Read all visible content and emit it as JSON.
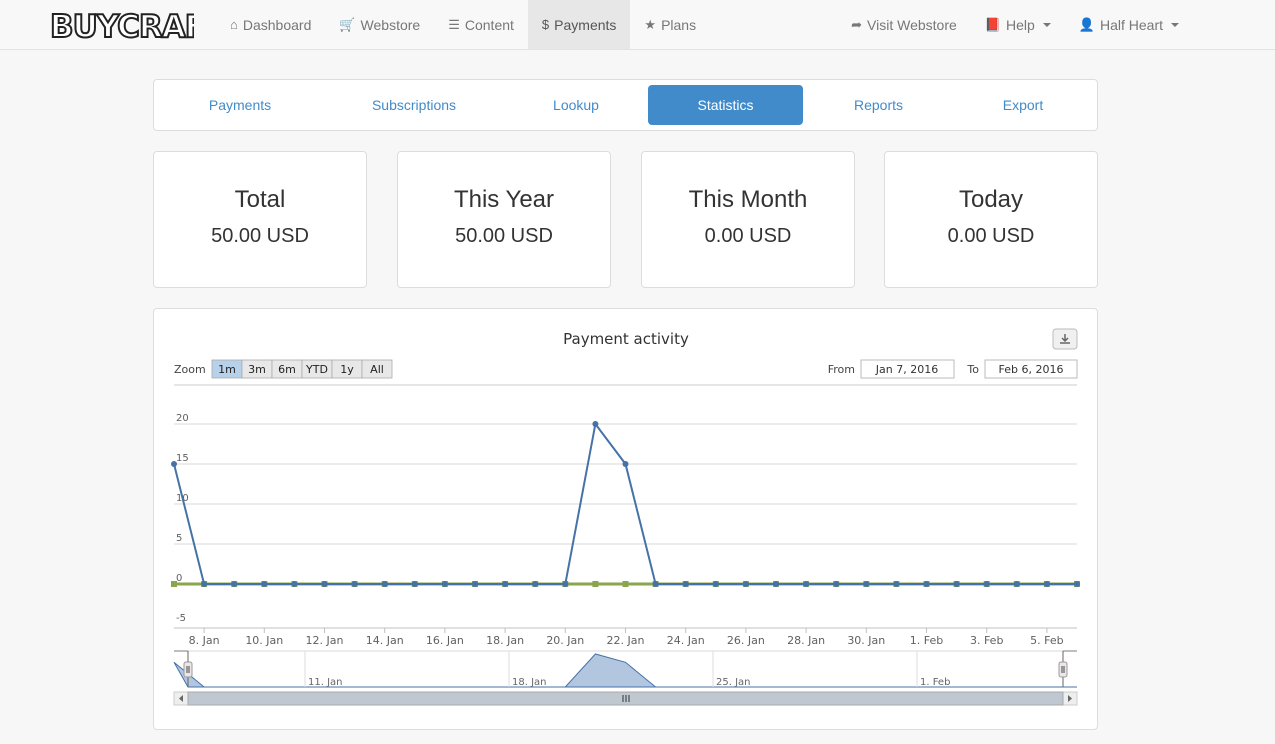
{
  "brand": {
    "logo_text": "BUYCRAFT"
  },
  "nav": {
    "left": [
      {
        "label": "Dashboard",
        "icon": "home-icon",
        "glyph": "⌂"
      },
      {
        "label": "Webstore",
        "icon": "cart-icon",
        "glyph": "🛒"
      },
      {
        "label": "Content",
        "icon": "list-icon",
        "glyph": "☰"
      },
      {
        "label": "Payments",
        "icon": "dollar-icon",
        "glyph": "$",
        "active": true
      },
      {
        "label": "Plans",
        "icon": "star-icon",
        "glyph": "★"
      }
    ],
    "right": [
      {
        "label": "Visit Webstore",
        "icon": "share-icon",
        "glyph": "➦"
      },
      {
        "label": "Help",
        "icon": "book-icon",
        "glyph": "📕",
        "dropdown": true
      },
      {
        "label": "Half Heart",
        "icon": "user-icon",
        "glyph": "👤",
        "dropdown": true
      }
    ]
  },
  "tabs": [
    "Payments",
    "Subscriptions",
    "Lookup",
    "Statistics",
    "Reports",
    "Export"
  ],
  "active_tab": "Statistics",
  "stats": [
    {
      "label": "Total",
      "value": "50.00 USD"
    },
    {
      "label": "This Year",
      "value": "50.00 USD"
    },
    {
      "label": "This Month",
      "value": "0.00 USD"
    },
    {
      "label": "Today",
      "value": "0.00 USD"
    }
  ],
  "chart": {
    "zoom_label": "Zoom",
    "zoom_buttons": [
      "1m",
      "3m",
      "6m",
      "YTD",
      "1y",
      "All"
    ],
    "zoom_selected": "1m",
    "from_label": "From",
    "from_value": "Jan 7, 2016",
    "to_label": "To",
    "to_value": "Feb 6, 2016",
    "export_icon": "download-icon"
  },
  "chart_data": {
    "type": "line",
    "title": "Payment activity",
    "xlabel": "",
    "ylabel": "",
    "ylim": [
      -5,
      20
    ],
    "yticks": [
      -5,
      0,
      5,
      10,
      15,
      20
    ],
    "x_tick_labels": [
      "8. Jan",
      "10. Jan",
      "12. Jan",
      "14. Jan",
      "16. Jan",
      "18. Jan",
      "20. Jan",
      "22. Jan",
      "24. Jan",
      "26. Jan",
      "28. Jan",
      "30. Jan",
      "1. Feb",
      "3. Feb",
      "5. Feb"
    ],
    "x_start": "2016-01-07",
    "x_end": "2016-02-06",
    "grid": true,
    "legend": "none",
    "series": [
      {
        "color": "#4572a7",
        "x": [
          "2016-01-07",
          "2016-01-08",
          "2016-01-09",
          "2016-01-10",
          "2016-01-11",
          "2016-01-12",
          "2016-01-13",
          "2016-01-14",
          "2016-01-15",
          "2016-01-16",
          "2016-01-17",
          "2016-01-18",
          "2016-01-19",
          "2016-01-20",
          "2016-01-21",
          "2016-01-22",
          "2016-01-23",
          "2016-01-24",
          "2016-01-25",
          "2016-01-26",
          "2016-01-27",
          "2016-01-28",
          "2016-01-29",
          "2016-01-30",
          "2016-01-31",
          "2016-02-01",
          "2016-02-02",
          "2016-02-03",
          "2016-02-04",
          "2016-02-05",
          "2016-02-06"
        ],
        "values": [
          15,
          0,
          0,
          0,
          0,
          0,
          0,
          0,
          0,
          0,
          0,
          0,
          0,
          0,
          20,
          15,
          0,
          0,
          0,
          0,
          0,
          0,
          0,
          0,
          0,
          0,
          0,
          0,
          0,
          0,
          0
        ]
      },
      {
        "color": "#89a54e",
        "x": [
          "2016-01-07",
          "2016-01-08",
          "2016-01-09",
          "2016-01-10",
          "2016-01-11",
          "2016-01-12",
          "2016-01-13",
          "2016-01-14",
          "2016-01-15",
          "2016-01-16",
          "2016-01-17",
          "2016-01-18",
          "2016-01-19",
          "2016-01-20",
          "2016-01-21",
          "2016-01-22",
          "2016-01-23",
          "2016-01-24",
          "2016-01-25",
          "2016-01-26",
          "2016-01-27",
          "2016-01-28",
          "2016-01-29",
          "2016-01-30",
          "2016-01-31",
          "2016-02-01",
          "2016-02-02",
          "2016-02-03",
          "2016-02-04",
          "2016-02-05",
          "2016-02-06"
        ],
        "values": [
          0,
          0,
          0,
          0,
          0,
          0,
          0,
          0,
          0,
          0,
          0,
          0,
          0,
          0,
          0,
          0,
          0,
          0,
          0,
          0,
          0,
          0,
          0,
          0,
          0,
          0,
          0,
          0,
          0,
          0,
          0
        ]
      }
    ],
    "navigator_labels": [
      "11. Jan",
      "18. Jan",
      "25. Jan",
      "1. Feb"
    ]
  }
}
